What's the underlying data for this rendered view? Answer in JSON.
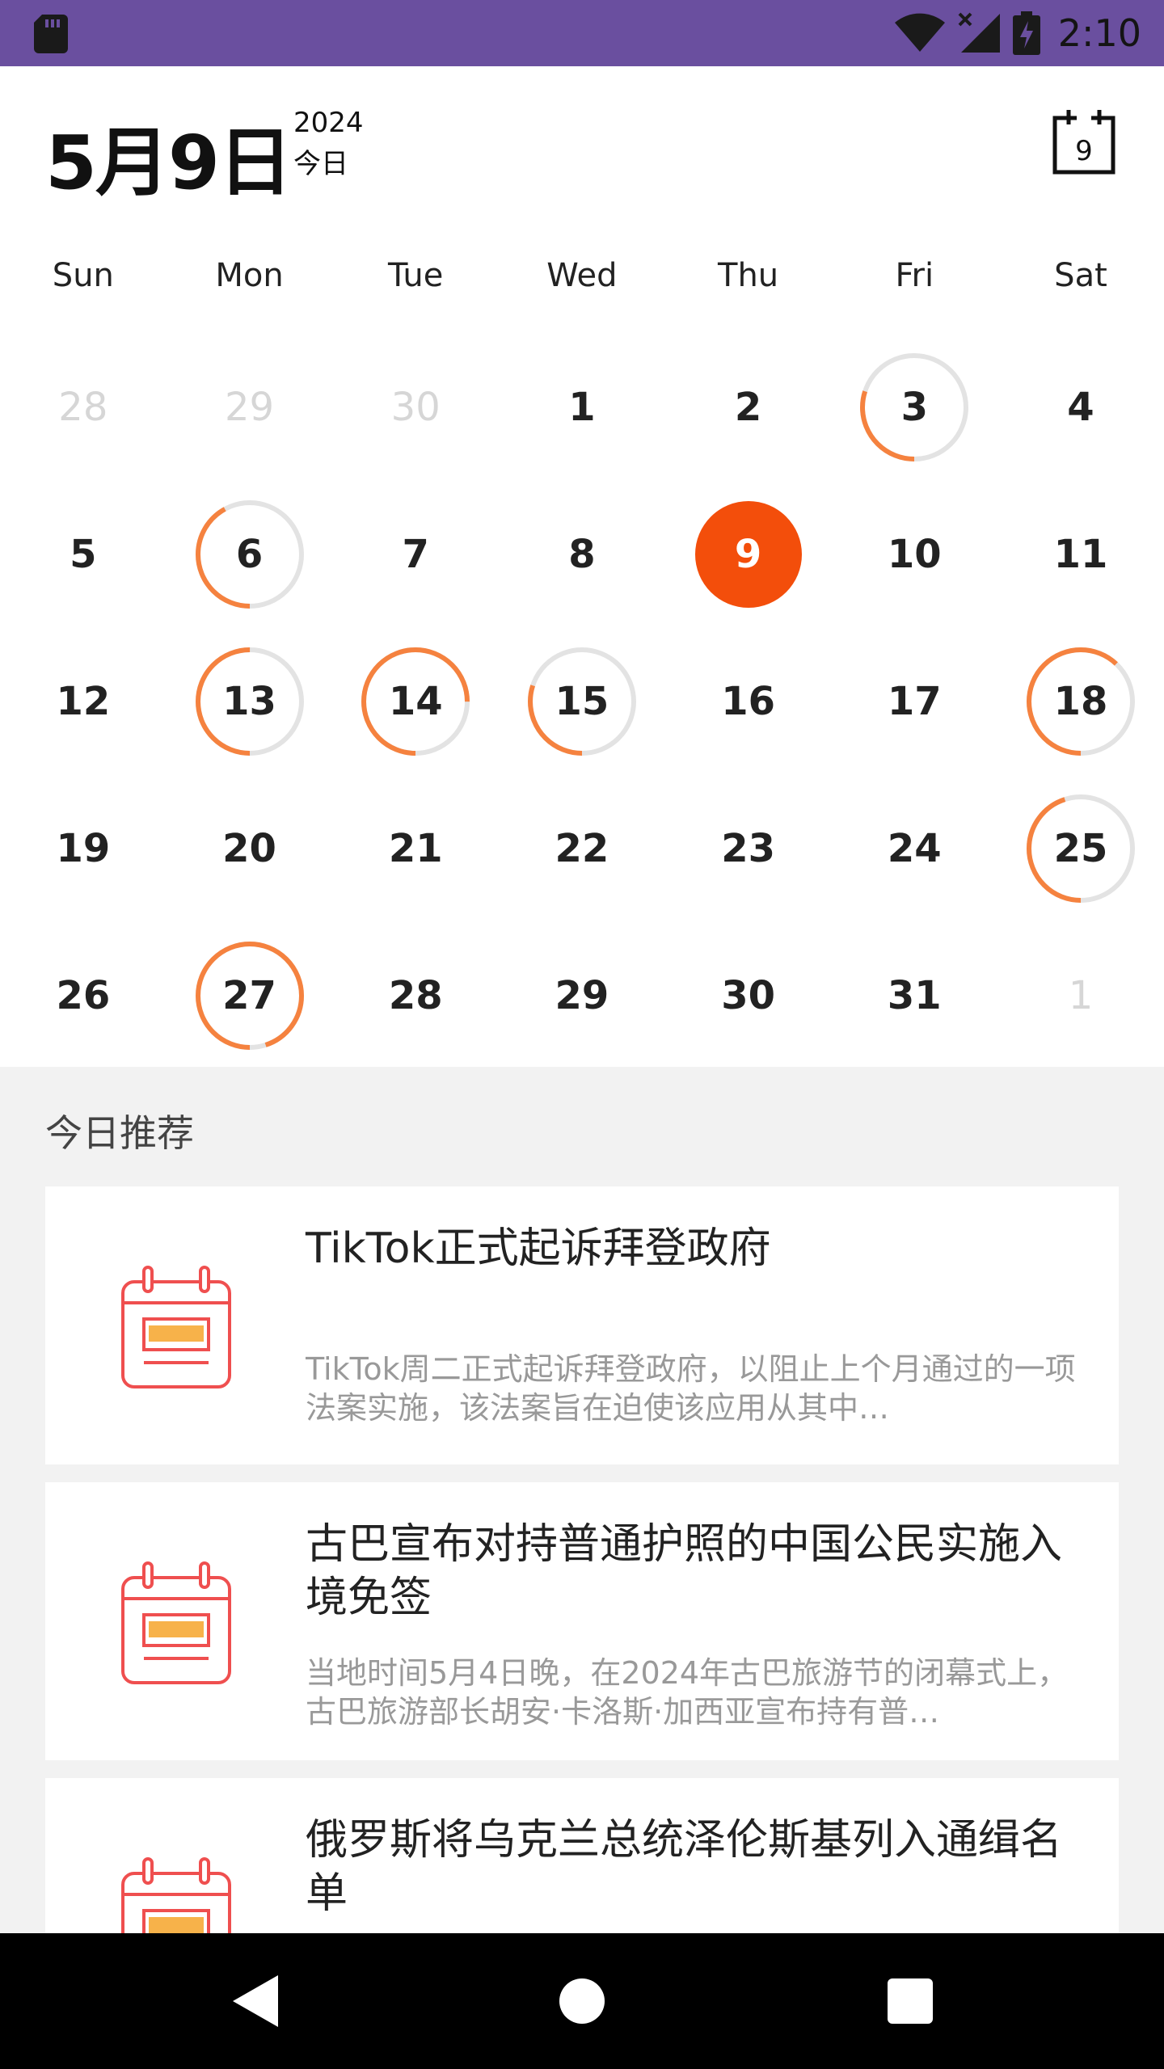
{
  "status_bar": {
    "time": "2:10",
    "icons": [
      "sd-card-icon",
      "wifi-icon",
      "cellular-no-signal-icon",
      "battery-charging-icon"
    ]
  },
  "header": {
    "date": "5月9日",
    "year": "2024",
    "today_label": "今日",
    "calendar_button_day": "9"
  },
  "calendar": {
    "weekdays": [
      "Sun",
      "Mon",
      "Tue",
      "Wed",
      "Thu",
      "Fri",
      "Sat"
    ],
    "accent_color": "#f34e0b",
    "ring_color": "#f5823f",
    "ring_track_color": "#e3e3e3",
    "weeks": [
      [
        {
          "label": "28",
          "out": true
        },
        {
          "label": "29",
          "out": true
        },
        {
          "label": "30",
          "out": true
        },
        {
          "label": "1"
        },
        {
          "label": "2"
        },
        {
          "label": "3",
          "progress": 0.3
        },
        {
          "label": "4"
        }
      ],
      [
        {
          "label": "5"
        },
        {
          "label": "6",
          "progress": 0.42
        },
        {
          "label": "7"
        },
        {
          "label": "8"
        },
        {
          "label": "9",
          "today": true
        },
        {
          "label": "10"
        },
        {
          "label": "11"
        }
      ],
      [
        {
          "label": "12"
        },
        {
          "label": "13",
          "progress": 0.5
        },
        {
          "label": "14",
          "progress": 0.75
        },
        {
          "label": "15",
          "progress": 0.3
        },
        {
          "label": "16"
        },
        {
          "label": "17"
        },
        {
          "label": "18",
          "progress": 0.62
        }
      ],
      [
        {
          "label": "19"
        },
        {
          "label": "20"
        },
        {
          "label": "21"
        },
        {
          "label": "22"
        },
        {
          "label": "23"
        },
        {
          "label": "24"
        },
        {
          "label": "25",
          "progress": 0.45
        }
      ],
      [
        {
          "label": "26"
        },
        {
          "label": "27",
          "progress": 0.95
        },
        {
          "label": "28"
        },
        {
          "label": "29"
        },
        {
          "label": "30"
        },
        {
          "label": "31"
        },
        {
          "label": "1",
          "out": true
        }
      ]
    ]
  },
  "recommend": {
    "title": "今日推荐",
    "items": [
      {
        "title": "TikTok正式起诉拜登政府",
        "summary": "TikTok周二正式起诉拜登政府，以阻止上个月通过的一项法案实施，该法案旨在迫使该应用从其中…"
      },
      {
        "title": "古巴宣布对持普通护照的中国公民实施入境免签",
        "summary": "当地时间5月4日晚，在2024年古巴旅游节的闭幕式上，古巴旅游部长胡安·卡洛斯·加西亚宣布持有普…"
      },
      {
        "title": "俄罗斯将乌克兰总统泽伦斯基列入通缉名单",
        "summary": ""
      }
    ]
  }
}
